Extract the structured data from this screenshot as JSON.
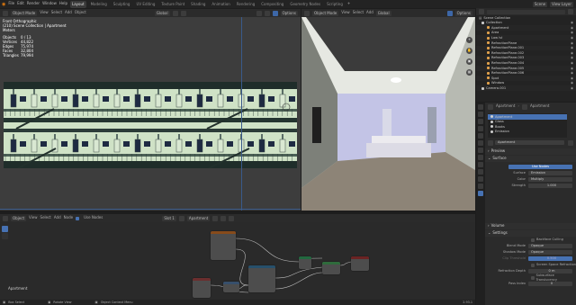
{
  "menu": [
    "File",
    "Edit",
    "Render",
    "Window",
    "Help"
  ],
  "workspaces": [
    "Layout",
    "Modeling",
    "Sculpting",
    "UV Editing",
    "Texture Paint",
    "Shading",
    "Animation",
    "Rendering",
    "Compositing",
    "Geometry Nodes",
    "Scripting"
  ],
  "active_workspace": "Layout",
  "scene": "Scene",
  "view_layer": "View Layer",
  "left_view": {
    "mode": "Object Mode",
    "menus": [
      "View",
      "Select",
      "Add",
      "Object"
    ],
    "orient": "Global",
    "options": "Options",
    "view_name": "Front Orthographic",
    "collection": "(210) Scene Collection | Apartment",
    "units": "Meters",
    "stats": [
      {
        "k": "Objects",
        "v": "0 / 13"
      },
      {
        "k": "Vertices",
        "v": "44,822"
      },
      {
        "k": "Edges",
        "v": "75,974"
      },
      {
        "k": "Faces",
        "v": "32,804"
      },
      {
        "k": "Triangles",
        "v": "79,994"
      }
    ]
  },
  "right_view": {
    "mode": "Object Mode",
    "menus": [
      "View",
      "Select",
      "Add"
    ],
    "orient": "Global",
    "options": "Options"
  },
  "node_editor": {
    "editor_type": "Object",
    "menus": [
      "View",
      "Select",
      "Add",
      "Node"
    ],
    "use_nodes": "Use Nodes",
    "slot": "Slot 1",
    "material": "Apartment",
    "label": "Apartment"
  },
  "outliner": {
    "title": "Scene Collection",
    "items": [
      {
        "name": "Collection",
        "indent": 0,
        "color": "#c8c8c8"
      },
      {
        "name": "Apartment",
        "indent": 1,
        "color": "#e0a14b"
      },
      {
        "name": "Area",
        "indent": 1,
        "color": "#e0a14b"
      },
      {
        "name": "Low lvl",
        "indent": 1,
        "color": "#e0a14b"
      },
      {
        "name": "RefractionPlane",
        "indent": 1,
        "color": "#e0a14b"
      },
      {
        "name": "RefractionPlane.001",
        "indent": 1,
        "color": "#e0a14b"
      },
      {
        "name": "RefractionPlane.002",
        "indent": 1,
        "color": "#e0a14b"
      },
      {
        "name": "RefractionPlane.003",
        "indent": 1,
        "color": "#e0a14b"
      },
      {
        "name": "RefractionPlane.004",
        "indent": 1,
        "color": "#e0a14b"
      },
      {
        "name": "RefractionPlane.005",
        "indent": 1,
        "color": "#e0a14b"
      },
      {
        "name": "RefractionPlane.006",
        "indent": 1,
        "color": "#e0a14b"
      },
      {
        "name": "Spot",
        "indent": 1,
        "color": "#e0a14b"
      },
      {
        "name": "Window",
        "indent": 1,
        "color": "#e0a14b"
      },
      {
        "name": "Camera.001",
        "indent": 0,
        "color": "#c8c8c8"
      }
    ]
  },
  "properties": {
    "object": "Apartment",
    "material": "Apartment",
    "slots": [
      "Apartment",
      "Glass",
      "Books",
      "Emission"
    ],
    "mat_field": "Apartment",
    "sections": {
      "preview": "Preview",
      "surface": "Surface",
      "volume": "Volume",
      "settings": "Settings"
    },
    "use_nodes": "Use Nodes",
    "surface_label": "Surface",
    "surface_value": "Emission",
    "color_label": "Color",
    "color_value": "Multiply",
    "strength_label": "Strength",
    "strength_value": "1.000",
    "backface": "Backface Culling",
    "blend_label": "Blend Mode",
    "blend_value": "Opaque",
    "shadow_label": "Shadow Mode",
    "shadow_value": "Opaque",
    "clip_label": "Clip Threshold",
    "clip_value": "0.500",
    "ssr": "Screen Space Refraction",
    "refdepth_label": "Refraction Depth",
    "refdepth_value": "0 m",
    "sst": "Subsurface Translucency",
    "pass_label": "Pass Index",
    "pass_value": "0"
  },
  "status": {
    "select": "Box Select",
    "rotate": "Rotate View",
    "context": "Object Context Menu",
    "version": "2.93.1"
  },
  "colors": {
    "accent": "#4772b3",
    "orange": "#e0a14b",
    "header": "#2b2b2b"
  }
}
